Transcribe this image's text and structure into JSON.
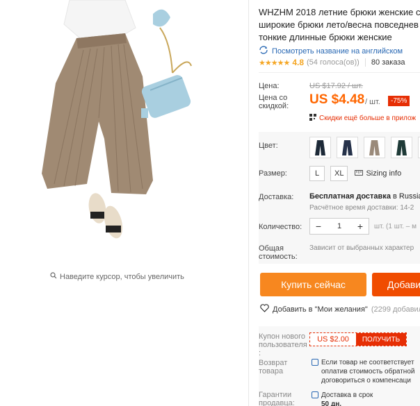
{
  "gallery": {
    "zoom_hint": "Наведите курсор, чтобы увеличить"
  },
  "product": {
    "title_lines": [
      "WHZHM 2018 летние брюки женские с",
      "широкие брюки лето/весна повседнев",
      "тонкие длинные брюки женские"
    ],
    "translate_link": "Посмотреть название на английском",
    "rating": "4.8",
    "votes": "(54 голоса(ов))",
    "orders": "80 заказа"
  },
  "price": {
    "label": "Цена:",
    "old": "US $17.92 / шт.",
    "discount_label": "Цена со скидкой:",
    "current": "US $4.48",
    "per_unit": "/ шт.",
    "discount_badge": "-75%",
    "extra": "Скидки ещё больше в прилож"
  },
  "props": {
    "color_label": "Цвет:",
    "size_label": "Размер:",
    "sizes": [
      "L",
      "XL"
    ],
    "sizing_info": "Sizing info",
    "shipping_label": "Доставка:",
    "shipping_main": "Бесплатная доставка",
    "shipping_dest": "в Russian",
    "shipping_time": "Расчётное время доставки: 14-2",
    "qty_label": "Количество:",
    "qty_value": "1",
    "qty_note": "шт. (1 шт. – м",
    "total_label": "Общая стоимость:",
    "total_note": "Зависит от выбранных характер"
  },
  "actions": {
    "buy": "Купить сейчас",
    "cart": "Добави",
    "wish": "Добавить в \"Мои желания\"",
    "wish_count": "(2299 добавили"
  },
  "lower": {
    "coupon_label": "Купон нового пользователя :",
    "coupon_value": "US $2.00",
    "coupon_button": "ПОЛУЧИТЬ",
    "return_label": "Возврат товара",
    "return_text": [
      "Если товар не соответствует",
      "оплатив стоимость обратной",
      "договориться о компенсаци"
    ],
    "guarantee_label": "Гарантии продавца:",
    "guarantee_text": [
      "Доставка в срок",
      "50 дн."
    ]
  },
  "colors": {
    "price": "#ff6600",
    "buy_button": "#f7871f",
    "cart_button": "#f04c00",
    "discount_badge": "#e62e04",
    "link": "#2767b3",
    "stars": "#f5a623"
  }
}
